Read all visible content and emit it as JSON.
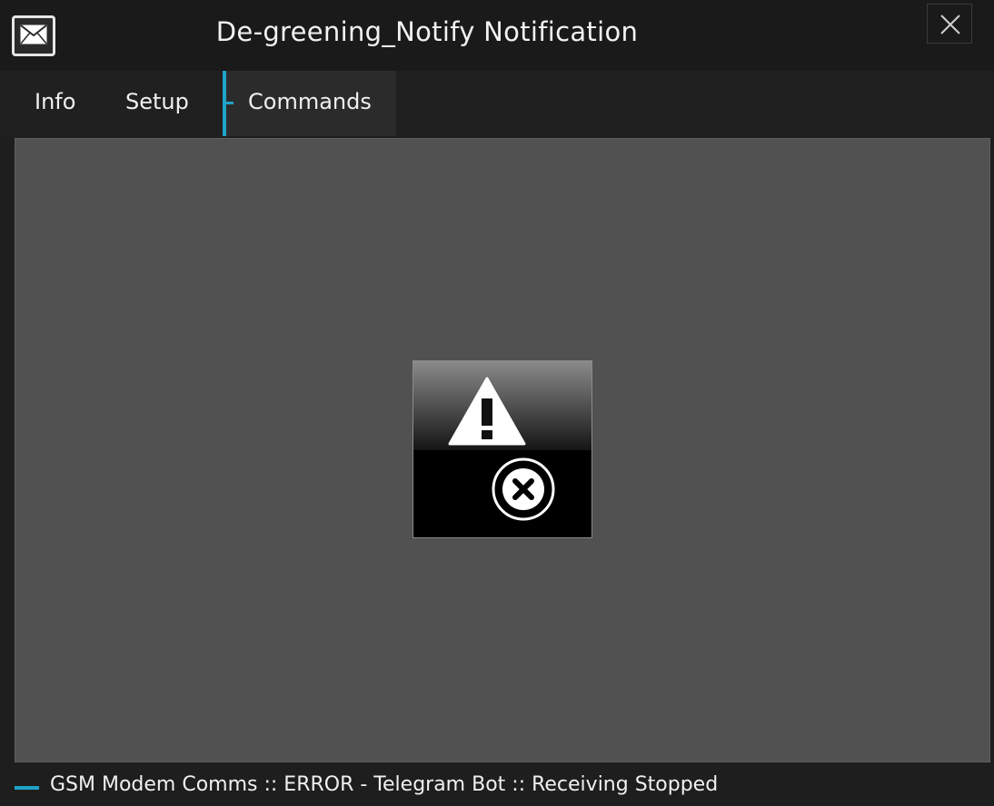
{
  "window": {
    "title": "De-greening_Notify Notification",
    "app_icon": "envelope-icon",
    "close_icon": "close-icon"
  },
  "tabs": [
    {
      "label": "Info",
      "active": false
    },
    {
      "label": "Setup",
      "active": false
    },
    {
      "label": "Commands",
      "active": true
    }
  ],
  "content": {
    "alert_tile": {
      "icons": [
        "warning-icon",
        "error-icon"
      ]
    }
  },
  "status": {
    "text": "GSM Modem Comms :: ERROR - Telegram Bot :: Receiving Stopped"
  },
  "colors": {
    "accent": "#1fa3c9",
    "panel": "#515151",
    "background": "#1e1e1e"
  }
}
